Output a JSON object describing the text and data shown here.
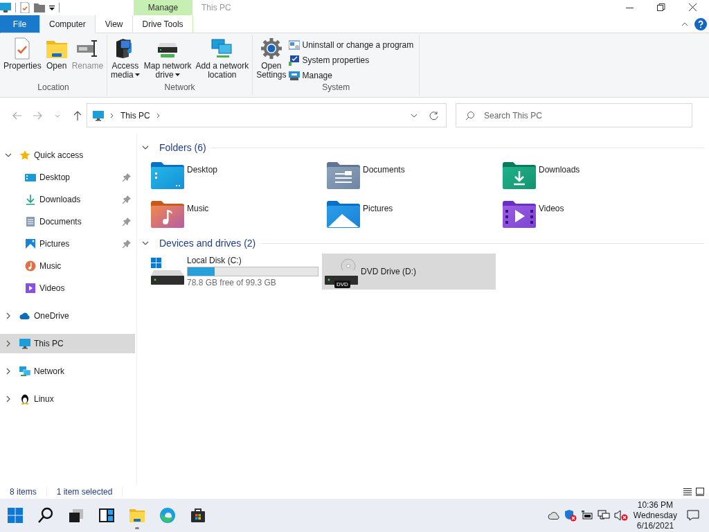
{
  "window": {
    "title": "This PC",
    "context_header": "Manage"
  },
  "ribbon": {
    "tabs": [
      {
        "label": "File",
        "kind": "file",
        "selected": false
      },
      {
        "label": "Computer",
        "kind": "tab",
        "selected": true
      },
      {
        "label": "View",
        "kind": "tab",
        "selected": false
      },
      {
        "label": "Drive Tools",
        "kind": "context",
        "selected": false
      }
    ],
    "groups": [
      {
        "label": "Location",
        "buttons": [
          {
            "label": "Properties",
            "kind": "properties",
            "disabled": false,
            "dropdown": false
          },
          {
            "label": "Open",
            "kind": "open",
            "disabled": false,
            "dropdown": false
          },
          {
            "label": "Rename",
            "kind": "rename",
            "disabled": true,
            "dropdown": false
          }
        ]
      },
      {
        "label": "Network",
        "buttons": [
          {
            "label": "Access\nmedia",
            "kind": "media",
            "disabled": false,
            "dropdown": true
          },
          {
            "label": "Map network\ndrive",
            "kind": "map-drive",
            "disabled": false,
            "dropdown": true
          },
          {
            "label": "Add a network\nlocation",
            "kind": "network-location",
            "disabled": false,
            "dropdown": false
          }
        ]
      },
      {
        "label": "System",
        "buttons": [
          {
            "label": "Open\nSettings",
            "kind": "settings",
            "disabled": false,
            "dropdown": false
          }
        ],
        "small_buttons": [
          {
            "label": "Uninstall or change a program",
            "kind": "uninstall"
          },
          {
            "label": "System properties",
            "kind": "system-properties"
          },
          {
            "label": "Manage",
            "kind": "manage"
          }
        ]
      }
    ]
  },
  "address": {
    "path": [
      "This PC"
    ],
    "search_placeholder": "Search This PC"
  },
  "navigation": [
    {
      "label": "Quick access",
      "kind": "star",
      "expanded": true,
      "selected": false,
      "children": [
        {
          "label": "Desktop",
          "kind": "desktop",
          "pinned": true,
          "selected": false
        },
        {
          "label": "Downloads",
          "kind": "downloads",
          "pinned": true,
          "selected": false
        },
        {
          "label": "Documents",
          "kind": "documents",
          "pinned": true,
          "selected": false
        },
        {
          "label": "Pictures",
          "kind": "pictures",
          "pinned": true,
          "selected": false
        },
        {
          "label": "Music",
          "kind": "music",
          "pinned": false,
          "selected": false
        },
        {
          "label": "Videos",
          "kind": "videos",
          "pinned": false,
          "selected": false
        }
      ]
    },
    {
      "label": "OneDrive",
      "kind": "cloud",
      "expanded": false,
      "selected": false
    },
    {
      "label": "This PC",
      "kind": "pc",
      "expanded": false,
      "selected": true
    },
    {
      "label": "Network",
      "kind": "network",
      "expanded": false,
      "selected": false
    },
    {
      "label": "Linux",
      "kind": "linux",
      "expanded": false,
      "selected": false
    }
  ],
  "sections": [
    {
      "title": "Folders (6)",
      "expanded": true,
      "folders": [
        {
          "label": "Desktop",
          "kind": "desktop"
        },
        {
          "label": "Documents",
          "kind": "documents"
        },
        {
          "label": "Downloads",
          "kind": "downloads"
        },
        {
          "label": "Music",
          "kind": "music"
        },
        {
          "label": "Pictures",
          "kind": "pictures"
        },
        {
          "label": "Videos",
          "kind": "videos"
        }
      ]
    },
    {
      "title": "Devices and drives (2)",
      "expanded": true,
      "drives": [
        {
          "label": "Local Disk (C:)",
          "kind": "disk",
          "level": 0.21,
          "free": "78.8 GB free of 99.3 GB",
          "selected": false
        },
        {
          "label": "DVD Drive (D:)",
          "kind": "dvd",
          "badge": "DVD",
          "selected": true
        }
      ]
    }
  ],
  "status_bar": {
    "count": "8 items",
    "selection": "1 item selected"
  },
  "taskbar": {
    "apps": [
      {
        "kind": "start",
        "active": false
      },
      {
        "kind": "search",
        "active": false
      },
      {
        "kind": "task-view",
        "active": false
      },
      {
        "kind": "widgets",
        "active": false
      },
      {
        "kind": "explorer",
        "active": true
      },
      {
        "kind": "browser",
        "active": false
      },
      {
        "kind": "store",
        "active": false
      }
    ],
    "clock": {
      "time": "10:36 PM",
      "day": "Wednesday",
      "date": "6/16/2021"
    }
  }
}
